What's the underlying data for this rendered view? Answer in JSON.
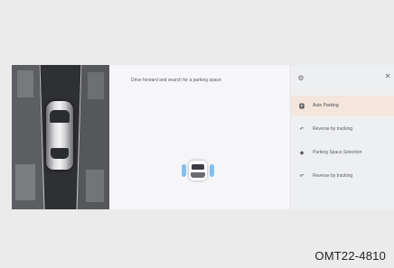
{
  "instruction": "Drive forward and search for a parking space",
  "panel": {
    "settings_icon": "gear-icon",
    "close_icon": "close-icon",
    "items": [
      {
        "label": "Auto Parking",
        "icon": "parking-icon",
        "active": true
      },
      {
        "label": "Reverse by tracking",
        "icon": "reverse-icon",
        "active": false
      },
      {
        "label": "Parking Space Selection",
        "icon": "parking-space-icon",
        "active": false
      },
      {
        "label": "Reverse by tracking",
        "icon": "reverse-icon",
        "active": false
      }
    ]
  },
  "caption": "OMT22-4810",
  "colors": {
    "active_item": "#f4e6dc",
    "sensor": "#6fb6f0",
    "background": "#ebebeb"
  }
}
